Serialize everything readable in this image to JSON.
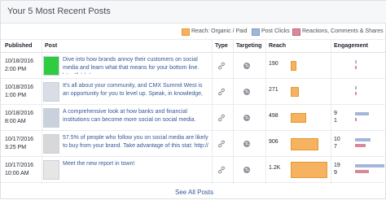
{
  "header": {
    "title": "Your 5 Most Recent Posts"
  },
  "legend": {
    "items": [
      {
        "label": "Reach: Organic / Paid",
        "color": "#f7b25f"
      },
      {
        "label": "Post Clicks",
        "color": "#a3b6d8"
      },
      {
        "label": "Reactions, Comments & Shares",
        "color": "#d88a9b"
      }
    ]
  },
  "columns": {
    "published": "Published",
    "post": "Post",
    "type": "Type",
    "targeting": "Targeting",
    "reach": "Reach",
    "engagement": "Engagement"
  },
  "rows": [
    {
      "date": "10/18/2016",
      "time": "2:00 PM",
      "thumb_color": "#2ecc40",
      "post": "Dive into how brands annoy their customers on social media and learn what that means for your bottom line. http://bit.ly/",
      "reach": "190",
      "reach_value": 190,
      "eng_a": "",
      "eng_b": "",
      "eng_a_value": 0,
      "eng_b_value": 0
    },
    {
      "date": "10/18/2016",
      "time": "1:00 PM",
      "thumb_color": "#d8dde6",
      "post": "It's all about your community, and CMX Summit West is an opportunity for you to level up. Speak, in knowledge, me",
      "reach": "271",
      "reach_value": 271,
      "eng_a": "",
      "eng_b": "",
      "eng_a_value": 0,
      "eng_b_value": 0
    },
    {
      "date": "10/18/2016",
      "time": "8:00 AM",
      "thumb_color": "#c9d1dc",
      "post": "A comprehensive look at how banks and financial institutions can become more social on social media.",
      "reach": "498",
      "reach_value": 498,
      "eng_a": "9",
      "eng_b": "1",
      "eng_a_value": 9,
      "eng_b_value": 1
    },
    {
      "date": "10/17/2016",
      "time": "3:25 PM",
      "thumb_color": "#d8d8d8",
      "post": "57.5% of people who follow you on social media are likely to buy from your brand. Take advantage of this stat: http://",
      "reach": "906",
      "reach_value": 906,
      "eng_a": "10",
      "eng_b": "7",
      "eng_a_value": 10,
      "eng_b_value": 7
    },
    {
      "date": "10/17/2016",
      "time": "10:00 AM",
      "thumb_color": "#e6e6e6",
      "post": "Meet the new report in town!",
      "reach": "1.2K",
      "reach_value": 1200,
      "eng_a": "19",
      "eng_b": "9",
      "eng_a_value": 19,
      "eng_b_value": 9
    }
  ],
  "footer": {
    "link": "See All Posts"
  }
}
